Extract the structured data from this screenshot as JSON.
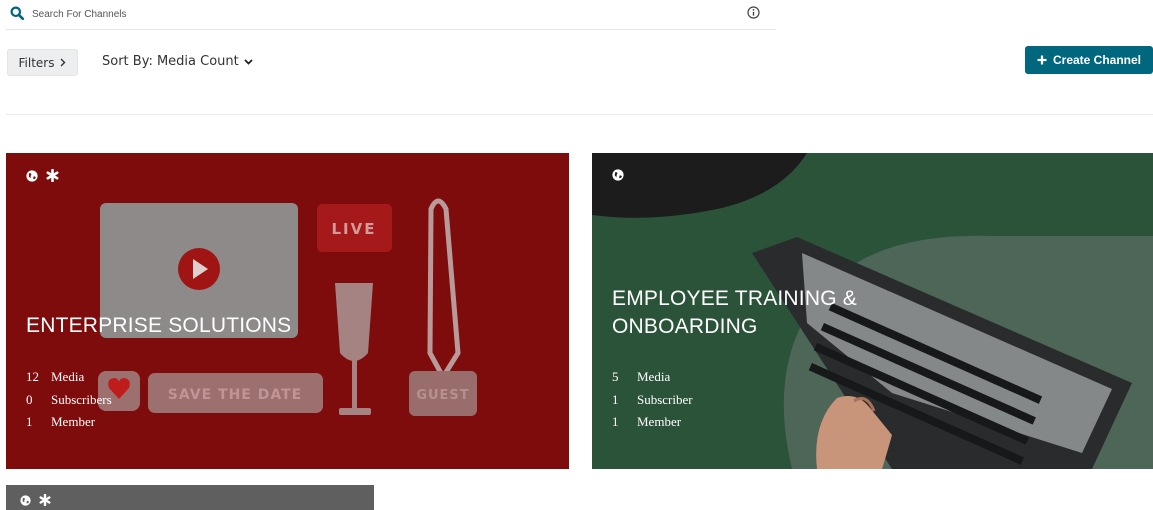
{
  "search": {
    "placeholder": "Search For Channels"
  },
  "toolbar": {
    "filters_label": "Filters",
    "sort_label": "Sort By: Media Count",
    "create_label": "Create Channel"
  },
  "colors": {
    "accent": "#00677f",
    "card1": "#7e0c0c",
    "card2": "#2b533a",
    "card3": "#5f5f5f"
  },
  "channels": [
    {
      "title": "ENTERPRISE SOLUTIONS",
      "icons": [
        "globe-icon",
        "asterisk-icon"
      ],
      "stats": [
        {
          "num": "12",
          "label": "Media"
        },
        {
          "num": "0",
          "label": "Subscribers"
        },
        {
          "num": "1",
          "label": "Member"
        }
      ]
    },
    {
      "title_line1": "EMPLOYEE TRAINING &",
      "title_line2": "ONBOARDING",
      "icons": [
        "globe-icon"
      ],
      "stats": [
        {
          "num": "5",
          "label": "Media"
        },
        {
          "num": "1",
          "label": "Subscriber"
        },
        {
          "num": "1",
          "label": "Member"
        }
      ]
    },
    {
      "icons": [
        "globe-icon",
        "asterisk-icon"
      ]
    }
  ]
}
